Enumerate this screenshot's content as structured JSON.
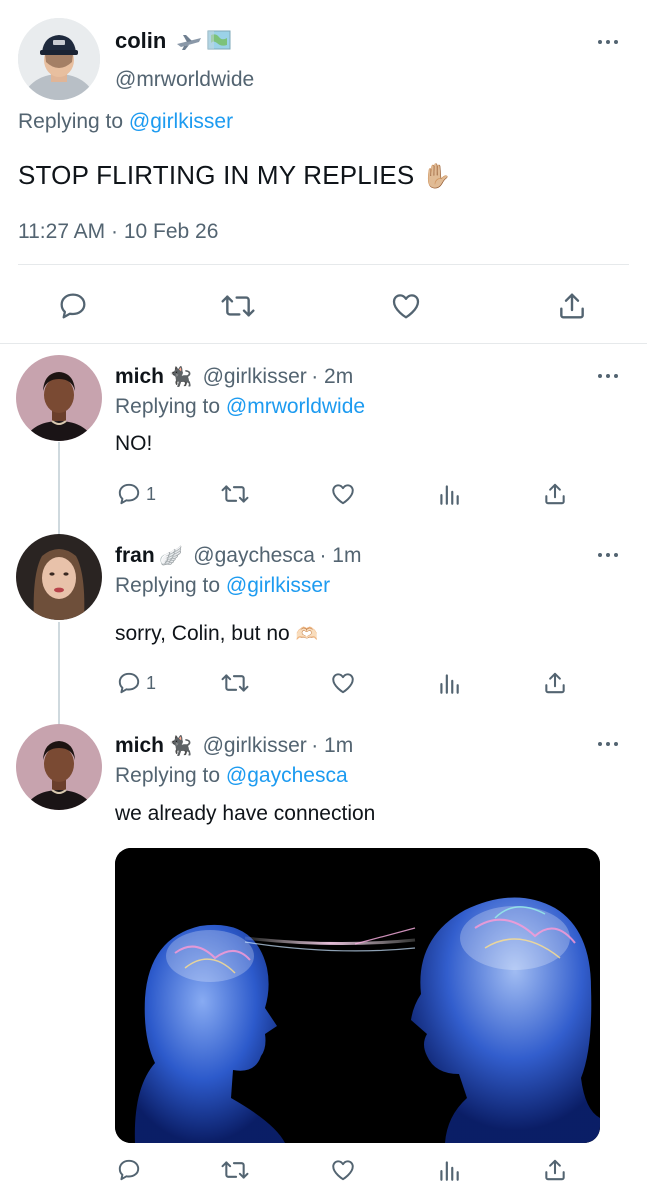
{
  "main_tweet": {
    "name": "colin",
    "handle": "@mrworldwide",
    "replying_prefix": "Replying to",
    "replying_to": "@girlkisser",
    "text": "STOP FLIRTING IN MY REPLIES",
    "emoji": "✋🏼",
    "timestamp": "11:27 AM · 10 Feb 26"
  },
  "replies": [
    {
      "name": "mich",
      "badge": "🐈‍⬛",
      "handle": "@girlkisser",
      "time": "· 2m",
      "replying_prefix": "Replying to",
      "replying_to": "@mrworldwide",
      "text": "NO!",
      "reply_count": "1"
    },
    {
      "name": "fran",
      "badge": "🪽",
      "handle": "@gaychesca",
      "time": "· 1m",
      "replying_prefix": "Replying to",
      "replying_to": "@girlkisser",
      "text": "sorry, Colin, but no",
      "emoji": "🫶🏻",
      "reply_count": "1"
    },
    {
      "name": "mich",
      "badge": "🐈‍⬛",
      "handle": "@girlkisser",
      "time": "· 1m",
      "replying_prefix": "Replying to",
      "replying_to": "@gaychesca",
      "text": "we already have connection"
    }
  ],
  "icons": {
    "reply": "reply-icon",
    "retweet": "retweet-icon",
    "like": "heart-icon",
    "views": "views-icon",
    "share": "share-icon",
    "more": "more-icon"
  },
  "colors": {
    "accent": "#1d9bf0",
    "muted": "#536471",
    "text": "#0f1419"
  }
}
